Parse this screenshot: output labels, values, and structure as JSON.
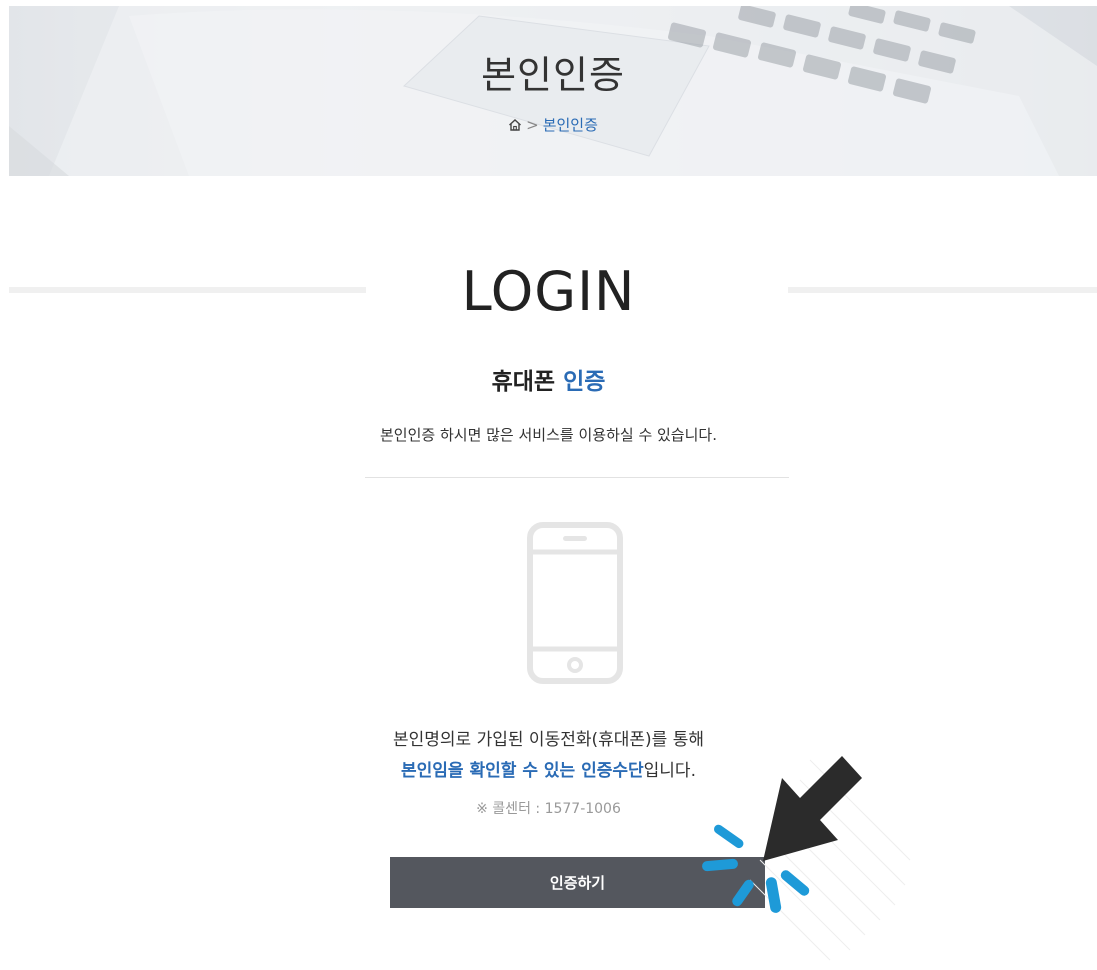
{
  "banner": {
    "title": "본인인증",
    "breadcrumb": {
      "home_icon": "home-icon",
      "separator": ">",
      "current": "본인인증"
    }
  },
  "main": {
    "heading": "LOGIN",
    "subtitle": {
      "prefix": "휴대폰",
      "accent": "인증"
    },
    "description": "본인인증 하시면 많은 서비스를 이용하실 수 있습니다.",
    "phone_icon": "smartphone-icon",
    "info": {
      "line1": "본인명의로 가입된 이동전화(휴대폰)를 통해",
      "line2_accent": "본인임을 확인할 수 있는 인증수단",
      "line2_suffix": "입니다."
    },
    "callcenter": "※ 콜센터 : 1577-1006",
    "button_label": "인증하기"
  },
  "overlay": {
    "cursor_icon": "arrow-cursor-icon",
    "click_effect": "click-burst-icon"
  },
  "colors": {
    "accent": "#2a6bb5",
    "button_bg": "#54575e",
    "cursor": "#2b2b2b",
    "click_burst": "#1e9ad8"
  }
}
